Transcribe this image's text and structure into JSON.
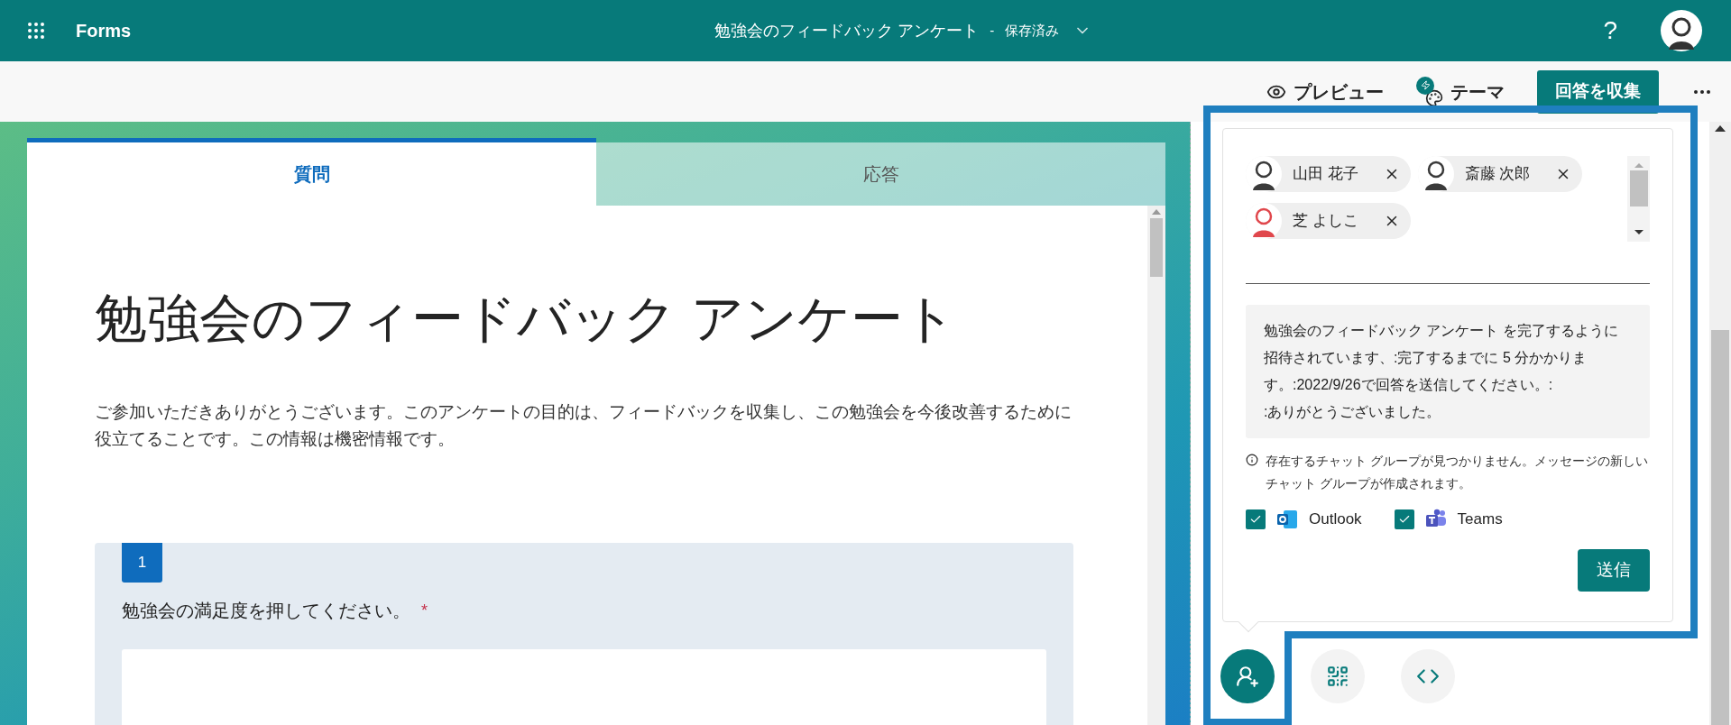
{
  "app_bar": {
    "app_name": "Forms",
    "form_title": "勉強会のフィードバック アンケート",
    "separator": "-",
    "save_status": "保存済み",
    "help": "?"
  },
  "toolbar": {
    "preview": "プレビュー",
    "theme": "テーマ",
    "collect": "回答を収集"
  },
  "form": {
    "tabs": [
      {
        "label": "質問",
        "selected": true
      },
      {
        "label": "応答",
        "selected": false
      }
    ],
    "title": "勉強会のフィードバック アンケート",
    "description": "ご参加いただきありがとうございます。このアンケートの目的は、フィードバックを収集し、この勉強会を今後改善するために役立てることです。この情報は機密情報です。",
    "questions": [
      {
        "number": "1",
        "text": "勉強会の満足度を押してください。",
        "required": true,
        "required_mark": "*"
      }
    ]
  },
  "share_panel": {
    "recipients": [
      {
        "name": "山田 花子",
        "color": "#3a3a3a"
      },
      {
        "name": "斎藤 次郎",
        "color": "#3a3a3a"
      },
      {
        "name": "芝 よしこ",
        "color": "#e0474c"
      }
    ],
    "message": "勉強会のフィードバック アンケート を完了するように招待されています、:完了するまでに 5 分かかります。:2022/9/26で回答を送信してください。:\n:ありがとうございました。",
    "notice": "存在するチャット グループが見つかりません。メッセージの新しいチャット グループが作成されます。",
    "channels": [
      {
        "kind": "outlook",
        "label": "Outlook",
        "checked": true
      },
      {
        "kind": "teams",
        "label": "Teams",
        "checked": true
      }
    ],
    "send": "送信",
    "share_modes": [
      {
        "kind": "invite",
        "selected": true
      },
      {
        "kind": "qr",
        "selected": false
      },
      {
        "kind": "embed",
        "selected": false
      }
    ]
  }
}
